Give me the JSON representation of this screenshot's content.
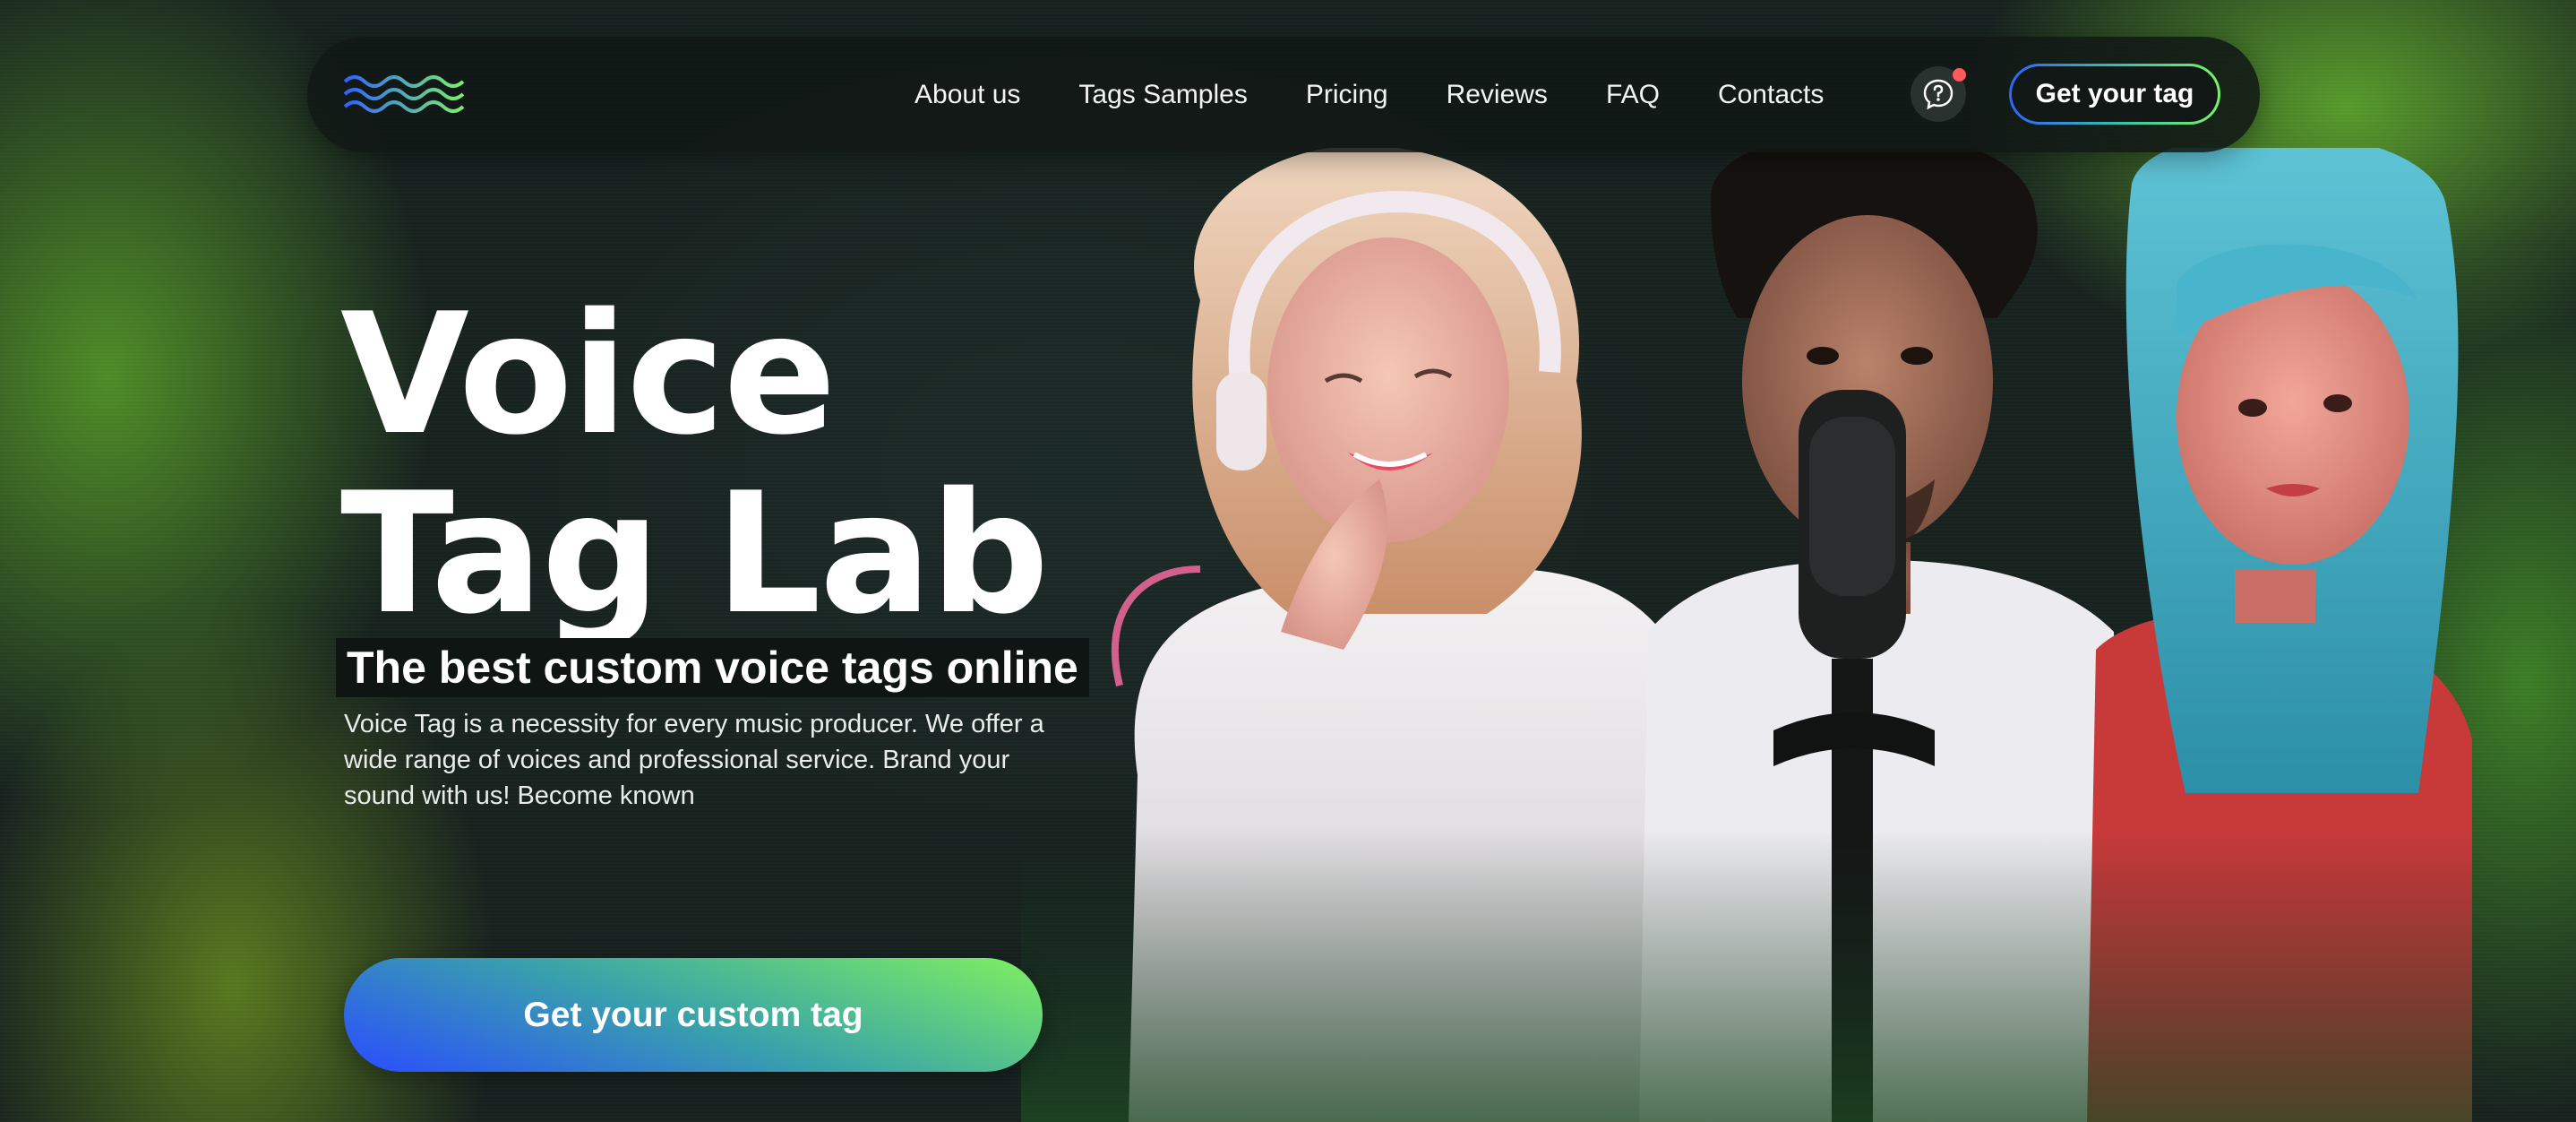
{
  "brand": {
    "logo_icon": "wave-logo-icon"
  },
  "nav": {
    "links": [
      {
        "label": "About us"
      },
      {
        "label": "Tags Samples"
      },
      {
        "label": "Pricing"
      },
      {
        "label": "Reviews"
      },
      {
        "label": "FAQ"
      },
      {
        "label": "Contacts"
      }
    ],
    "support_icon": "chat-question-icon",
    "cta_label": "Get your tag"
  },
  "hero": {
    "title_line1": "Voice",
    "title_line2": "Tag Lab",
    "subtitle": "The best custom voice tags online",
    "description": "Voice Tag is a necessity for every music producer. We offer a wide range of voices and professional service. Brand your sound with us! Become known",
    "cta_label": "Get your custom tag"
  },
  "colors": {
    "accent_blue": "#2f63ff",
    "accent_green": "#7cf06a",
    "background": "#1a2a22",
    "notification_dot": "#ff5a5a"
  }
}
